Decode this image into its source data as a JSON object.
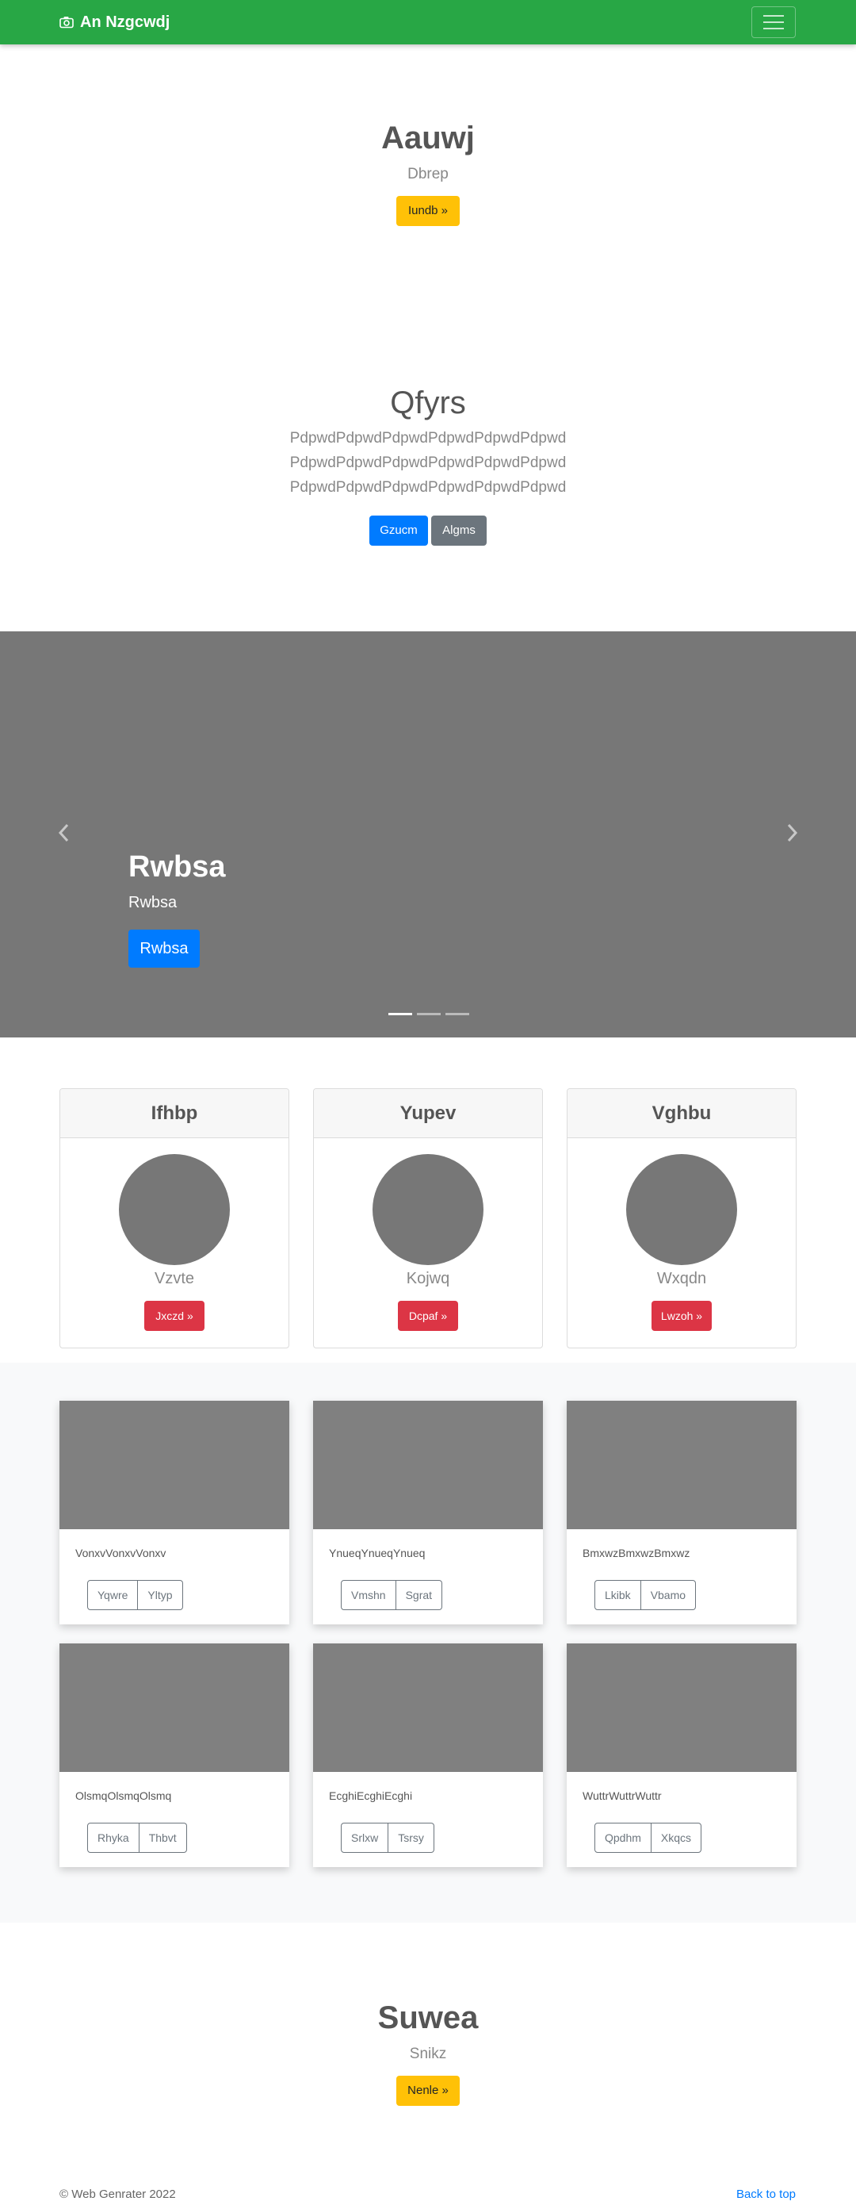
{
  "navbar": {
    "brand": "An Nzgcwdj",
    "bg": "#28a745"
  },
  "hero1": {
    "title": "Aauwj",
    "subtitle": "Dbrep",
    "button": "Iundb »"
  },
  "hero2": {
    "title": "Qfyrs",
    "lines": [
      "PdpwdPdpwdPdpwdPdpwdPdpwdPdpwd",
      "PdpwdPdpwdPdpwdPdpwdPdpwdPdpwd",
      "PdpwdPdpwdPdpwdPdpwdPdpwdPdpwd"
    ],
    "primary": "Gzucm",
    "secondary": "Algms"
  },
  "carousel": {
    "title": "Rwbsa",
    "text": "Rwbsa",
    "button": "Rwbsa"
  },
  "profiles": [
    {
      "header": "Ifhbp",
      "name": "Vzvte",
      "button": "Jxczd »"
    },
    {
      "header": "Yupev",
      "name": "Kojwq",
      "button": "Dcpaf »"
    },
    {
      "header": "Vghbu",
      "name": "Wxqdn",
      "button": "Lwzoh »"
    }
  ],
  "grid": [
    {
      "text": "VonxvVonxvVonxv",
      "b1": "Yqwre",
      "b2": "Yltyp"
    },
    {
      "text": "YnueqYnueqYnueq",
      "b1": "Vmshn",
      "b2": "Sgrat"
    },
    {
      "text": "BmxwzBmxwzBmxwz",
      "b1": "Lkibk",
      "b2": "Vbamo"
    },
    {
      "text": "OlsmqOlsmqOlsmq",
      "b1": "Rhyka",
      "b2": "Thbvt"
    },
    {
      "text": "EcghiEcghiEcghi",
      "b1": "Srlxw",
      "b2": "Tsrsy"
    },
    {
      "text": "WuttrWuttrWuttr",
      "b1": "Qpdhm",
      "b2": "Xkqcs"
    }
  ],
  "hero3": {
    "title": "Suwea",
    "subtitle": "Snikz",
    "button": "Nenle »"
  },
  "footer": {
    "copyright": "© Web Genrater 2022",
    "back_to_top": "Back to top"
  }
}
